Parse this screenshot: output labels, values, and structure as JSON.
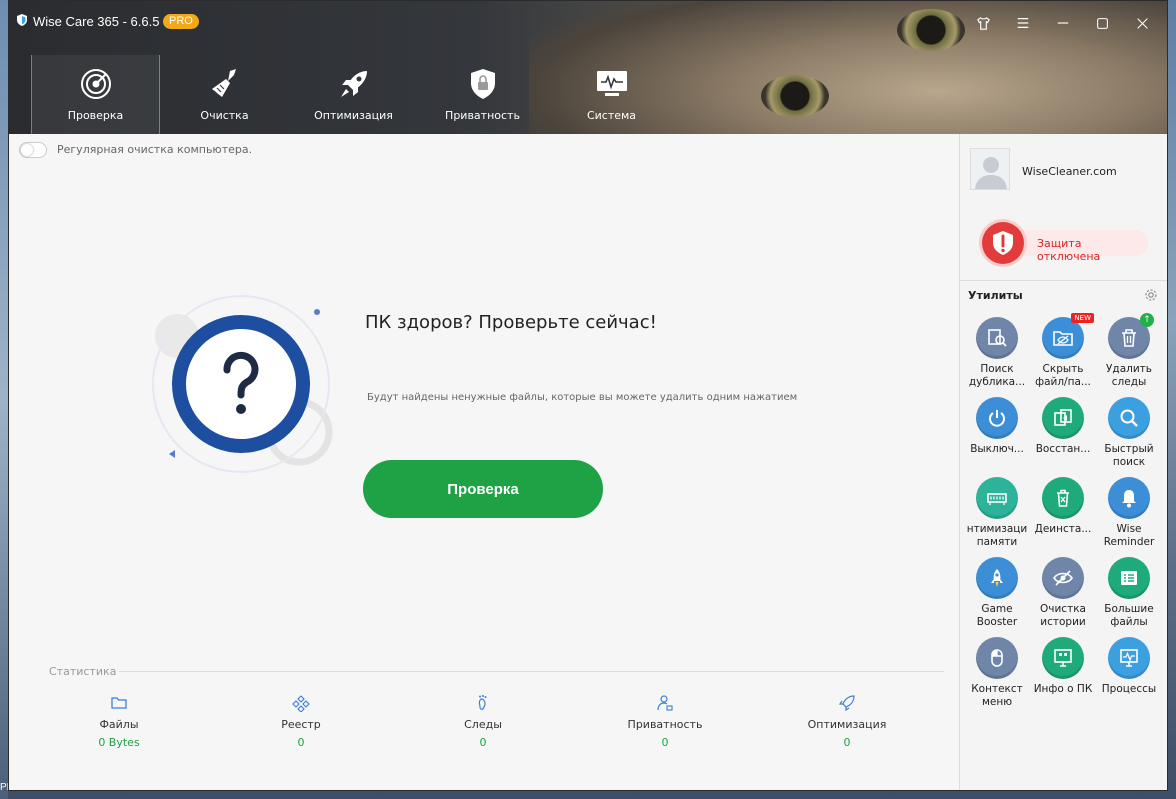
{
  "window": {
    "title": "Wise Care 365 - 6.6.5",
    "badge": "PRO"
  },
  "nav": [
    {
      "label": "Проверка",
      "icon": "radar-icon"
    },
    {
      "label": "Очистка",
      "icon": "broom-icon"
    },
    {
      "label": "Оптимизация",
      "icon": "rocket-icon"
    },
    {
      "label": "Приватность",
      "icon": "privacy-lock-icon"
    },
    {
      "label": "Система",
      "icon": "monitor-pulse-icon"
    }
  ],
  "main": {
    "toggle_label": "Регулярная очистка компьютера.",
    "headline": "ПК здоров? Проверьте сейчас!",
    "subtext": "Будут найдены ненужные файлы, которые вы можете удалить одним нажатием",
    "scan_button": "Проверка"
  },
  "stats": {
    "title": "Статистика",
    "items": [
      {
        "label": "Файлы",
        "value": "0 Bytes"
      },
      {
        "label": "Реестр",
        "value": "0"
      },
      {
        "label": "Следы",
        "value": "0"
      },
      {
        "label": "Приватность",
        "value": "0"
      },
      {
        "label": "Оптимизация",
        "value": "0"
      }
    ]
  },
  "sidebar": {
    "user": "WiseCleaner.com",
    "protection": "Защита отключена",
    "utilities_title": "Утилиты",
    "tools": [
      {
        "line1": "Поиск",
        "line2": "дублика...",
        "color": "#6f86a8"
      },
      {
        "line1": "Скрыть",
        "line2": "файл/па...",
        "color": "#3c8fd6",
        "badge": "NEW"
      },
      {
        "line1": "Удалить",
        "line2": "следы",
        "color": "#6f86a8"
      },
      {
        "line1": "Выключ...",
        "line2": "",
        "color": "#3c8fd6"
      },
      {
        "line1": "Восстан...",
        "line2": "",
        "color": "#1eaa7a"
      },
      {
        "line1": "Быстрый",
        "line2": "поиск",
        "color": "#3c9fe0"
      },
      {
        "line1": "нтимизаци",
        "line2": "памяти",
        "color": "#2cb39a"
      },
      {
        "line1": "Деинста...",
        "line2": "",
        "color": "#1eaa7a"
      },
      {
        "line1": "Wise",
        "line2": "Reminder",
        "color": "#3c8fd6"
      },
      {
        "line1": "Game",
        "line2": "Booster",
        "color": "#3c8fd6"
      },
      {
        "line1": "Очистка",
        "line2": "истории",
        "color": "#6f86a8"
      },
      {
        "line1": "Большие",
        "line2": "файлы",
        "color": "#1eaa7a"
      },
      {
        "line1": "Контекст",
        "line2": "меню",
        "color": "#6f86a8"
      },
      {
        "line1": "Инфо о ПК",
        "line2": "",
        "color": "#1eaa7a"
      },
      {
        "line1": "Процессы",
        "line2": "",
        "color": "#3c9fe0"
      }
    ]
  },
  "desktop": {
    "taskbar_text": "PBPclient"
  }
}
